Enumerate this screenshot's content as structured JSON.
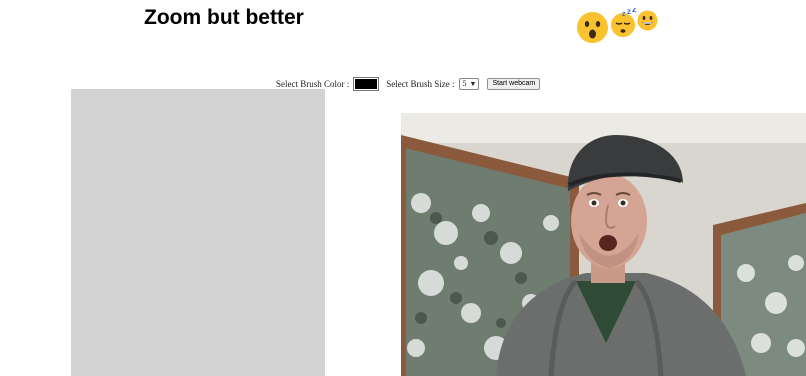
{
  "page": {
    "title": "Zoom but better"
  },
  "emojis": [
    "surprised-face",
    "sleeping-face",
    "grinning-face"
  ],
  "controls": {
    "brush_color_label": "Select Brush Color :",
    "brush_color_value": "#000000",
    "brush_size_label": "Select Brush Size :",
    "brush_size_value": "5",
    "webcam_button_label": "Start webcam"
  },
  "colors": {
    "canvas_background": "#d3d3d3",
    "emoji_yellow": "#fbc02d"
  }
}
